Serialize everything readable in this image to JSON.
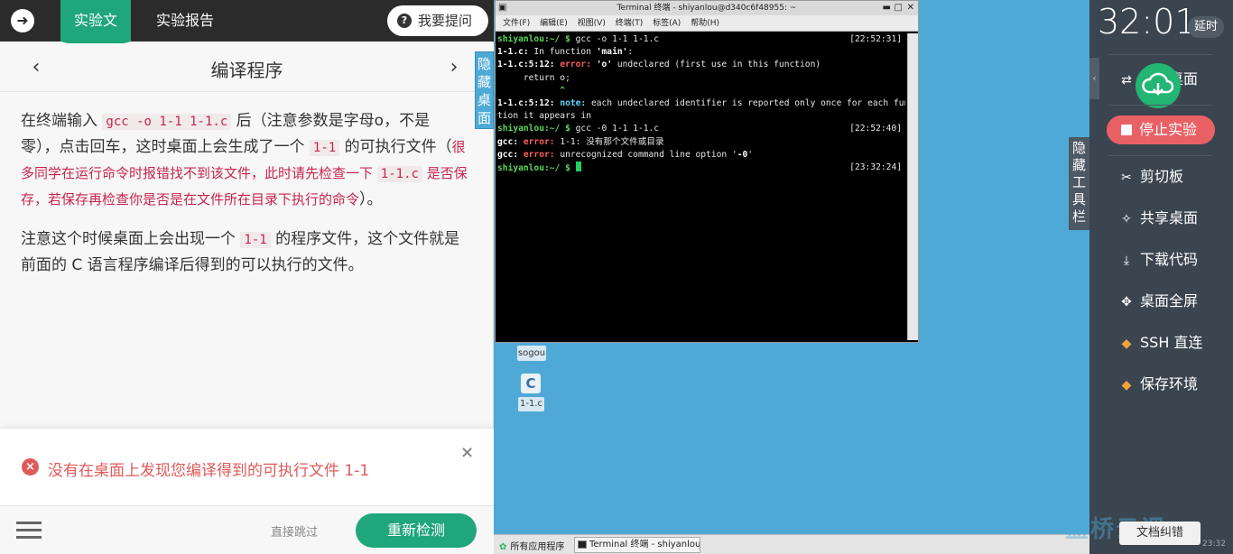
{
  "left_panel": {
    "tabs": {
      "docs": "实验文档",
      "report": "实验报告"
    },
    "ask_button": "我要提问",
    "nav_title": "编译程序",
    "content": {
      "p1_a": "在终端输入",
      "p1_code1": "gcc -o 1-1 1-1.c",
      "p1_b": "后（注意参数是字母o，不是零），点击回车，这时桌面上会生成了一个",
      "p1_code2": "1-1",
      "p1_c": "的可执行文件（",
      "p1_hint_a": "很多同学在运行命令时报错找不到该文件，此时请先检查一下",
      "p1_hint_code": "1-1.c",
      "p1_hint_b": "是否保存，若保存再检查你是否是在文件所在目录下执行的命令",
      "p1_d": "）。",
      "p2_a": "注意这个时候桌面上会出现一个",
      "p2_code": "1-1",
      "p2_b": "的程序文件，这个文件就是前面的 C 语言程序编译后得到的可以执行的文件。"
    },
    "error_message": "没有在桌面上发现您编译得到的可执行文件 1-1",
    "skip_label": "直接跳过",
    "recheck_label": "重新检测",
    "hide_desktop": "隐藏桌面"
  },
  "terminal": {
    "title": "Terminal 终端 - shiyanlou@d340c6f48955: ~",
    "menu": [
      "文件(F)",
      "编辑(E)",
      "视图(V)",
      "终端(T)",
      "标签(A)",
      "帮助(H)"
    ],
    "prompt": "shiyanlou:~/ $",
    "lines": {
      "cmd1": " gcc -o 1-1 1-1.c",
      "ts1": "[22:52:31]",
      "l2_file": "1-1.c:",
      "l2_text": " In function ",
      "l2_fn": "'main'",
      "l2_end": ":",
      "l3_loc": "1-1.c:5:12:",
      "l3_err": " error: ",
      "l3_o": "'o'",
      "l3_text": " undeclared (first use in this function)",
      "l4": "     return o;",
      "l5": "            ^",
      "l6_loc": "1-1.c:5:12:",
      "l6_note": " note:",
      "l6_text": " each undeclared identifier is reported only once for each func",
      "l7": "tion it appears in",
      "cmd2": " gcc -0 1-1 1-1.c",
      "ts2": "[22:52:40]",
      "l9_gcc": "gcc:",
      "l9_err": " error:",
      "l9_text": " 1-1: 没有那个文件或目录",
      "l10_gcc": "gcc:",
      "l10_err": " error:",
      "l10_text": " unrecognized command line option '",
      "l10_opt": "-0",
      "l10_end": "'",
      "ts3": "[23:32:24]"
    }
  },
  "desktop": {
    "sogou_label": "sogou",
    "c_icon": "C",
    "file_label": "1-1.c",
    "taskbar_apps": "所有应用程序",
    "taskbar_term": "Terminal 终端 - shiyanlou@···",
    "hide_toolbar": "隐藏工具栏"
  },
  "right_panel": {
    "timer": "32:01",
    "delay": "延时",
    "switch_desktop": "切换桌面",
    "stop": "停止实验",
    "clipboard": "剪切板",
    "share_desktop": "共享桌面",
    "download_code": "下载代码",
    "fullscreen": "桌面全屏",
    "ssh": "SSH 直连",
    "save_env": "保存环境",
    "doc_error": "文档纠错",
    "watermark": "蓝桥云课",
    "corner_time": "23:32"
  },
  "colors": {
    "accent_green": "#1fa67a",
    "error_red": "#e05a5a",
    "desktop_blue": "#4ea9d6",
    "sidebar_dark": "#3b4550",
    "stop_red": "#e96165"
  }
}
